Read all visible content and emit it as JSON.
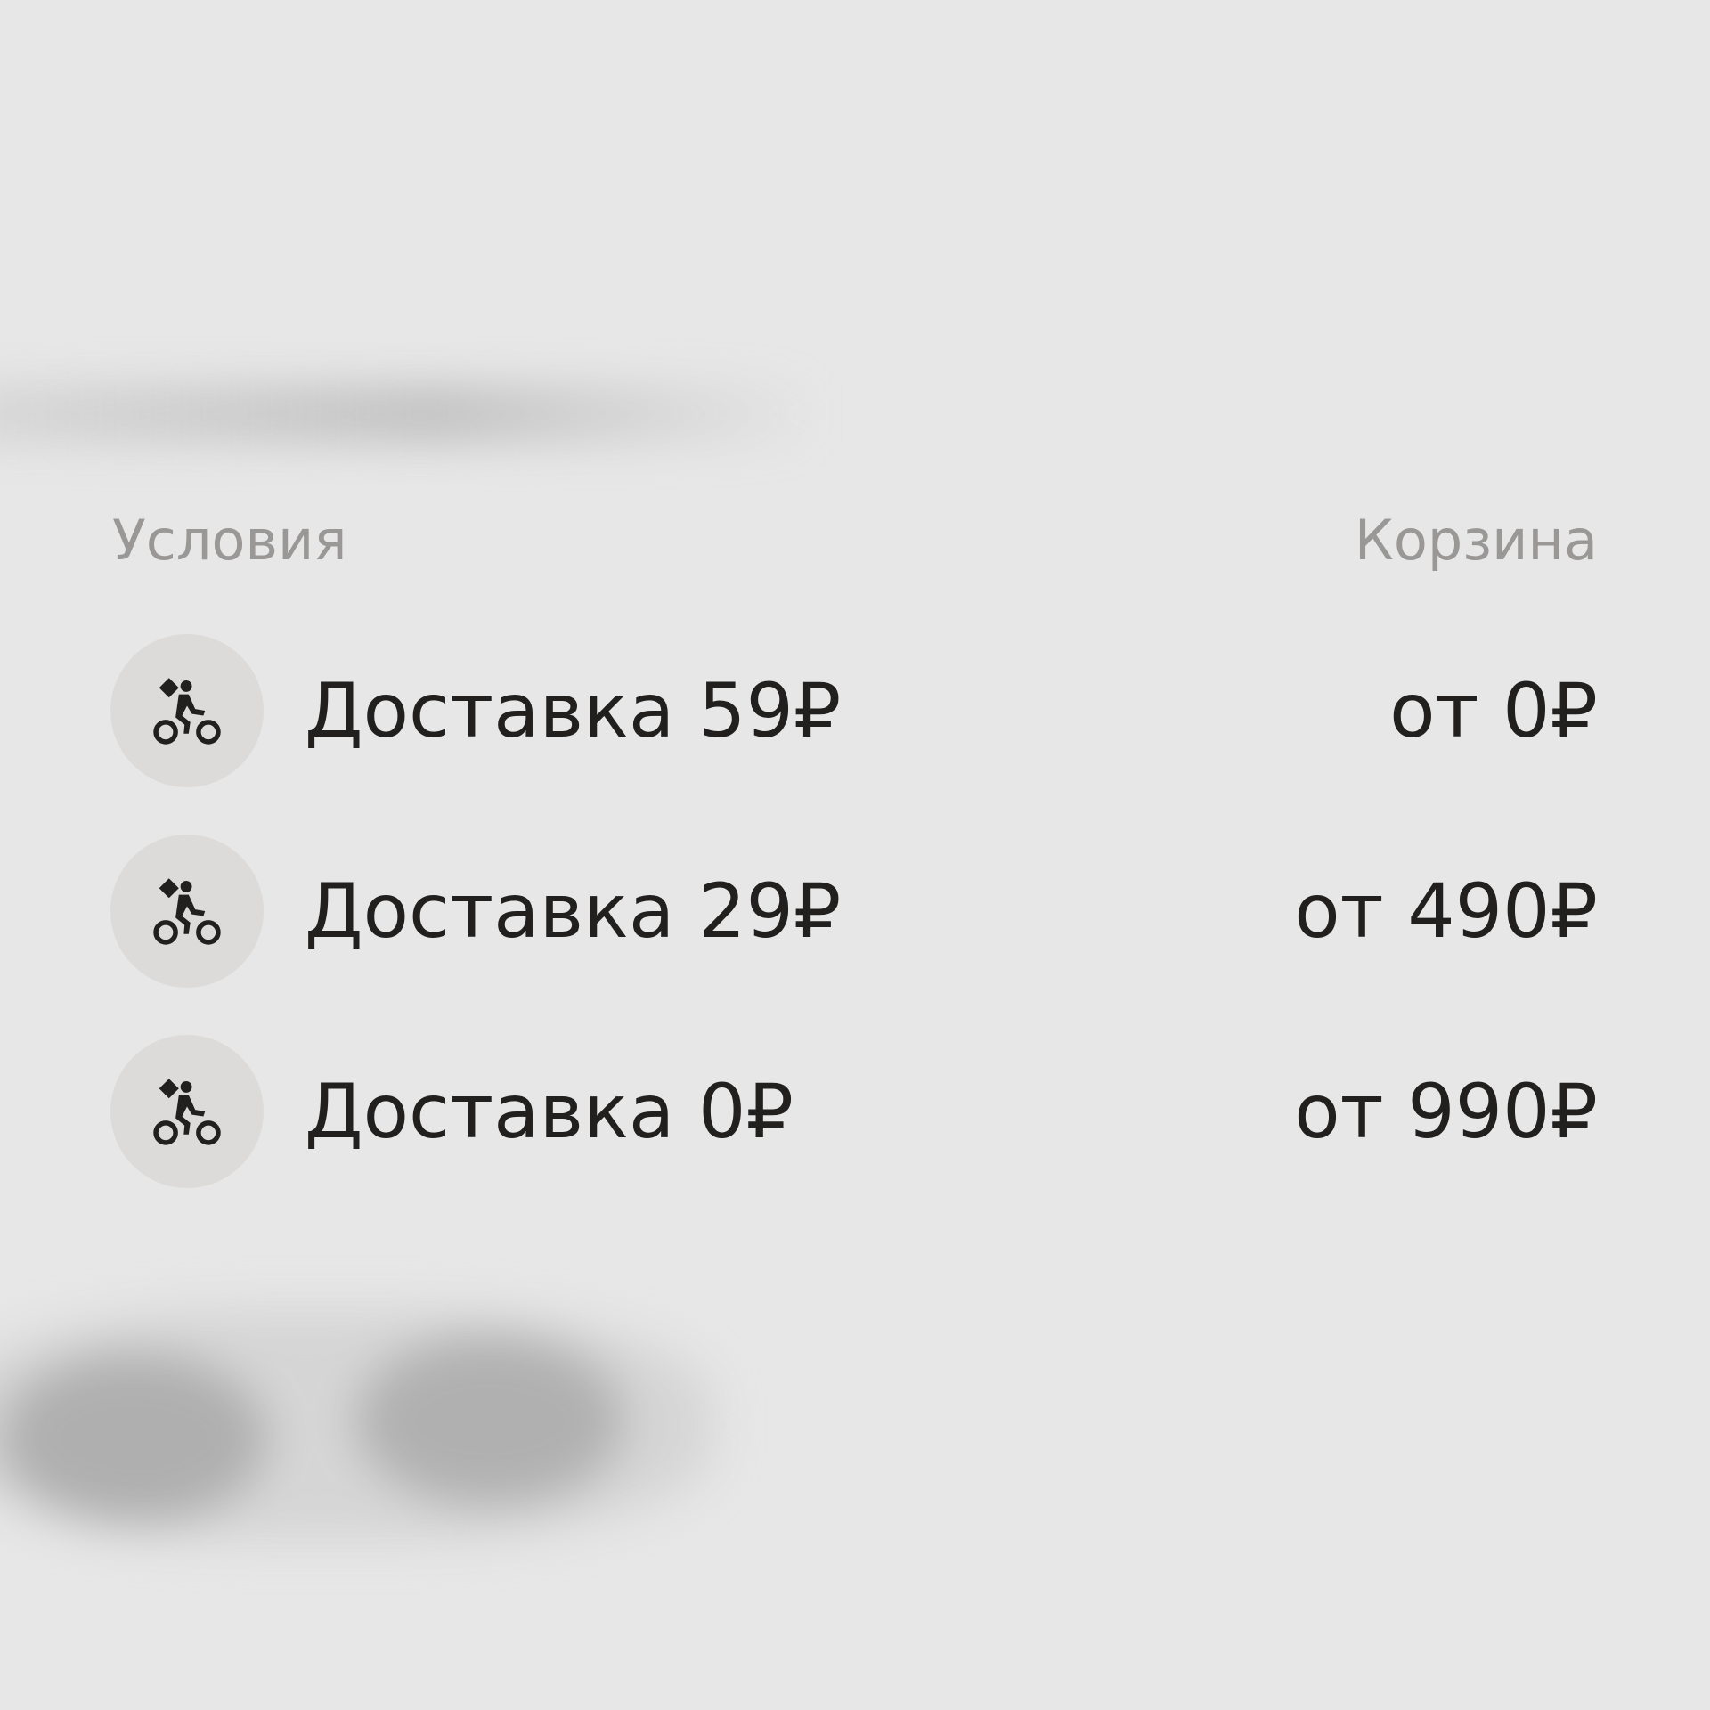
{
  "header": {
    "conditions_label": "Условия",
    "cart_label": "Корзина"
  },
  "rows": [
    {
      "icon": "courier-bike-icon",
      "label": "Доставка 59₽",
      "value": "от 0₽"
    },
    {
      "icon": "courier-bike-icon",
      "label": "Доставка 29₽",
      "value": "от 490₽"
    },
    {
      "icon": "courier-bike-icon",
      "label": "Доставка 0₽",
      "value": "от 990₽"
    }
  ],
  "colors": {
    "background": "#e7e7e7",
    "icon_circle": "#dddbd9",
    "primary_text": "#21201f",
    "secondary_text": "#9a9896"
  }
}
